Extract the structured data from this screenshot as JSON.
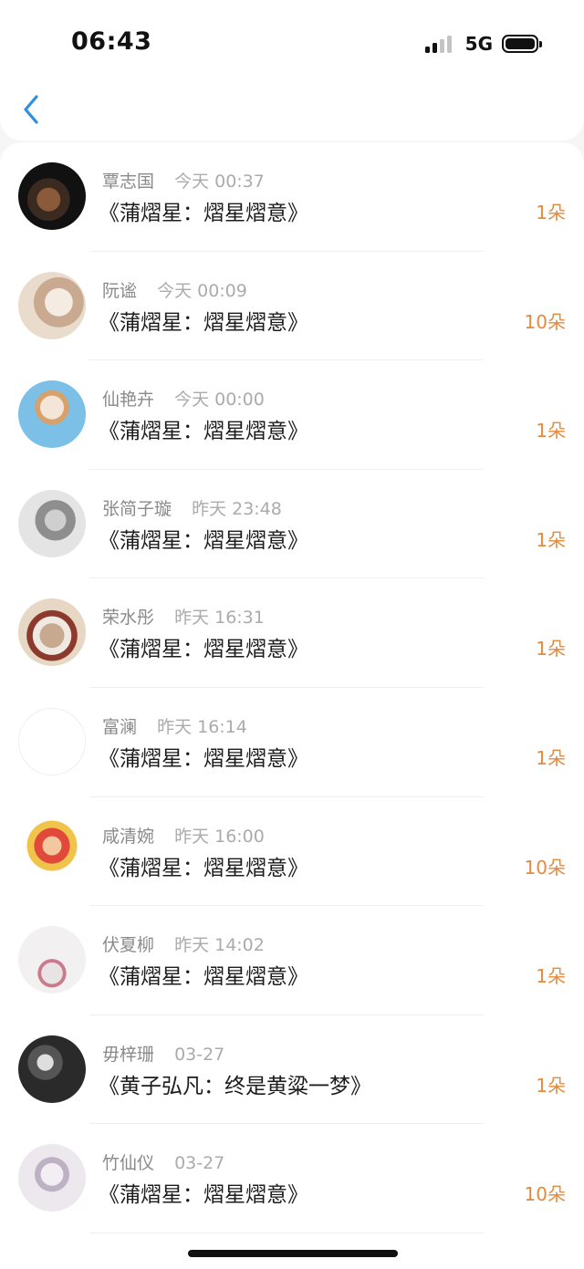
{
  "status_bar": {
    "time": "06:43",
    "network": "5G"
  },
  "header": {
    "back_icon": "chevron-left-icon",
    "accent": "#2f8fe0"
  },
  "colors": {
    "count": "#e58a3c"
  },
  "items": [
    {
      "name": "覃志国",
      "time": "今天 00:37",
      "title": "《蒲熠星：熠星熠意》",
      "count": "1朵"
    },
    {
      "name": "阮谧",
      "time": "今天 00:09",
      "title": "《蒲熠星：熠星熠意》",
      "count": "10朵"
    },
    {
      "name": "仙艳卉",
      "time": "今天 00:00",
      "title": "《蒲熠星：熠星熠意》",
      "count": "1朵"
    },
    {
      "name": "张简子璇",
      "time": "昨天 23:48",
      "title": "《蒲熠星：熠星熠意》",
      "count": "1朵"
    },
    {
      "name": "荣水彤",
      "time": "昨天 16:31",
      "title": "《蒲熠星：熠星熠意》",
      "count": "1朵"
    },
    {
      "name": "富澜",
      "time": "昨天 16:14",
      "title": "《蒲熠星：熠星熠意》",
      "count": "1朵"
    },
    {
      "name": "咸清婉",
      "time": "昨天 16:00",
      "title": "《蒲熠星：熠星熠意》",
      "count": "10朵"
    },
    {
      "name": "伏夏柳",
      "time": "昨天 14:02",
      "title": "《蒲熠星：熠星熠意》",
      "count": "1朵"
    },
    {
      "name": "毋梓珊",
      "time": "03-27",
      "title": "《黄子弘凡：终是黄粱一梦》",
      "count": "1朵"
    },
    {
      "name": "竹仙仪",
      "time": "03-27",
      "title": "《蒲熠星：熠星熠意》",
      "count": "10朵"
    }
  ]
}
